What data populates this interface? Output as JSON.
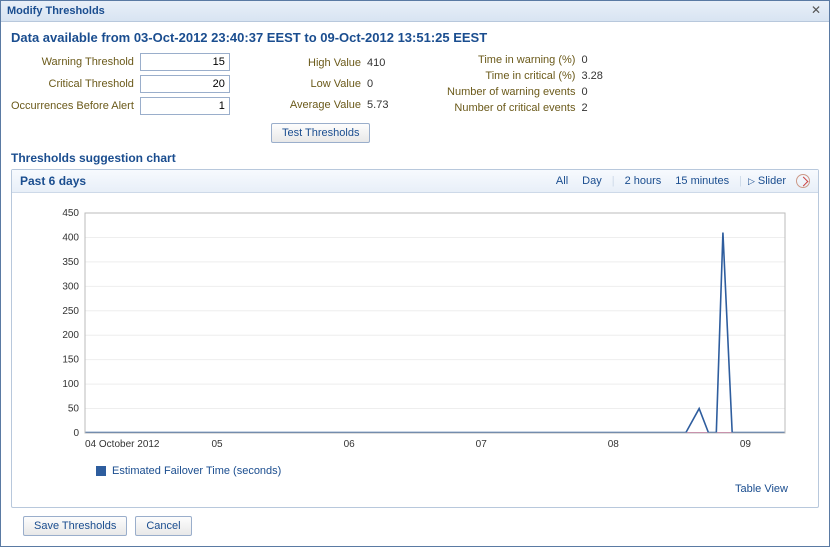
{
  "window": {
    "title": "Modify Thresholds"
  },
  "data_range": "Data available from 03-Oct-2012 23:40:37 EEST to 09-Oct-2012 13:51:25 EEST",
  "inputs": {
    "warning_label": "Warning Threshold",
    "warning_value": "15",
    "critical_label": "Critical Threshold",
    "critical_value": "20",
    "occurrences_label": "Occurrences Before Alert",
    "occurrences_value": "1"
  },
  "test_button": "Test Thresholds",
  "stats1": {
    "high_label": "High Value",
    "high_value": "410",
    "low_label": "Low Value",
    "low_value": "0",
    "avg_label": "Average Value",
    "avg_value": "5.73"
  },
  "stats2": {
    "tw_label": "Time in warning (%)",
    "tw_value": "0",
    "tc_label": "Time in critical (%)",
    "tc_value": "3.28",
    "nw_label": "Number of warning events",
    "nw_value": "0",
    "nc_label": "Number of critical events",
    "nc_value": "2"
  },
  "section_title": "Thresholds suggestion chart",
  "chart_head": {
    "range": "Past 6 days",
    "all": "All",
    "day": "Day",
    "two_hours": "2 hours",
    "fifteen": "15 minutes",
    "slider": "Slider"
  },
  "legend": "Estimated Failover Time (seconds)",
  "table_view": "Table View",
  "footer": {
    "save": "Save Thresholds",
    "cancel": "Cancel"
  },
  "chart_data": {
    "type": "line",
    "title": "",
    "xlabel": "",
    "ylabel": "",
    "x_ticks": [
      "04 October 2012",
      "05",
      "06",
      "07",
      "08",
      "09"
    ],
    "ylim": [
      0,
      450
    ],
    "y_ticks": [
      0,
      50,
      100,
      150,
      200,
      250,
      300,
      350,
      400,
      450
    ],
    "series": [
      {
        "name": "Estimated Failover Time (seconds)",
        "color": "#2e5d9e",
        "x": [
          0,
          1,
          2,
          3,
          4,
          4.55,
          4.65,
          4.72,
          4.78,
          4.83,
          4.9,
          5,
          5.3
        ],
        "values": [
          1,
          1,
          1,
          1,
          1,
          1,
          50,
          1,
          1,
          410,
          1,
          1,
          1
        ]
      }
    ]
  }
}
